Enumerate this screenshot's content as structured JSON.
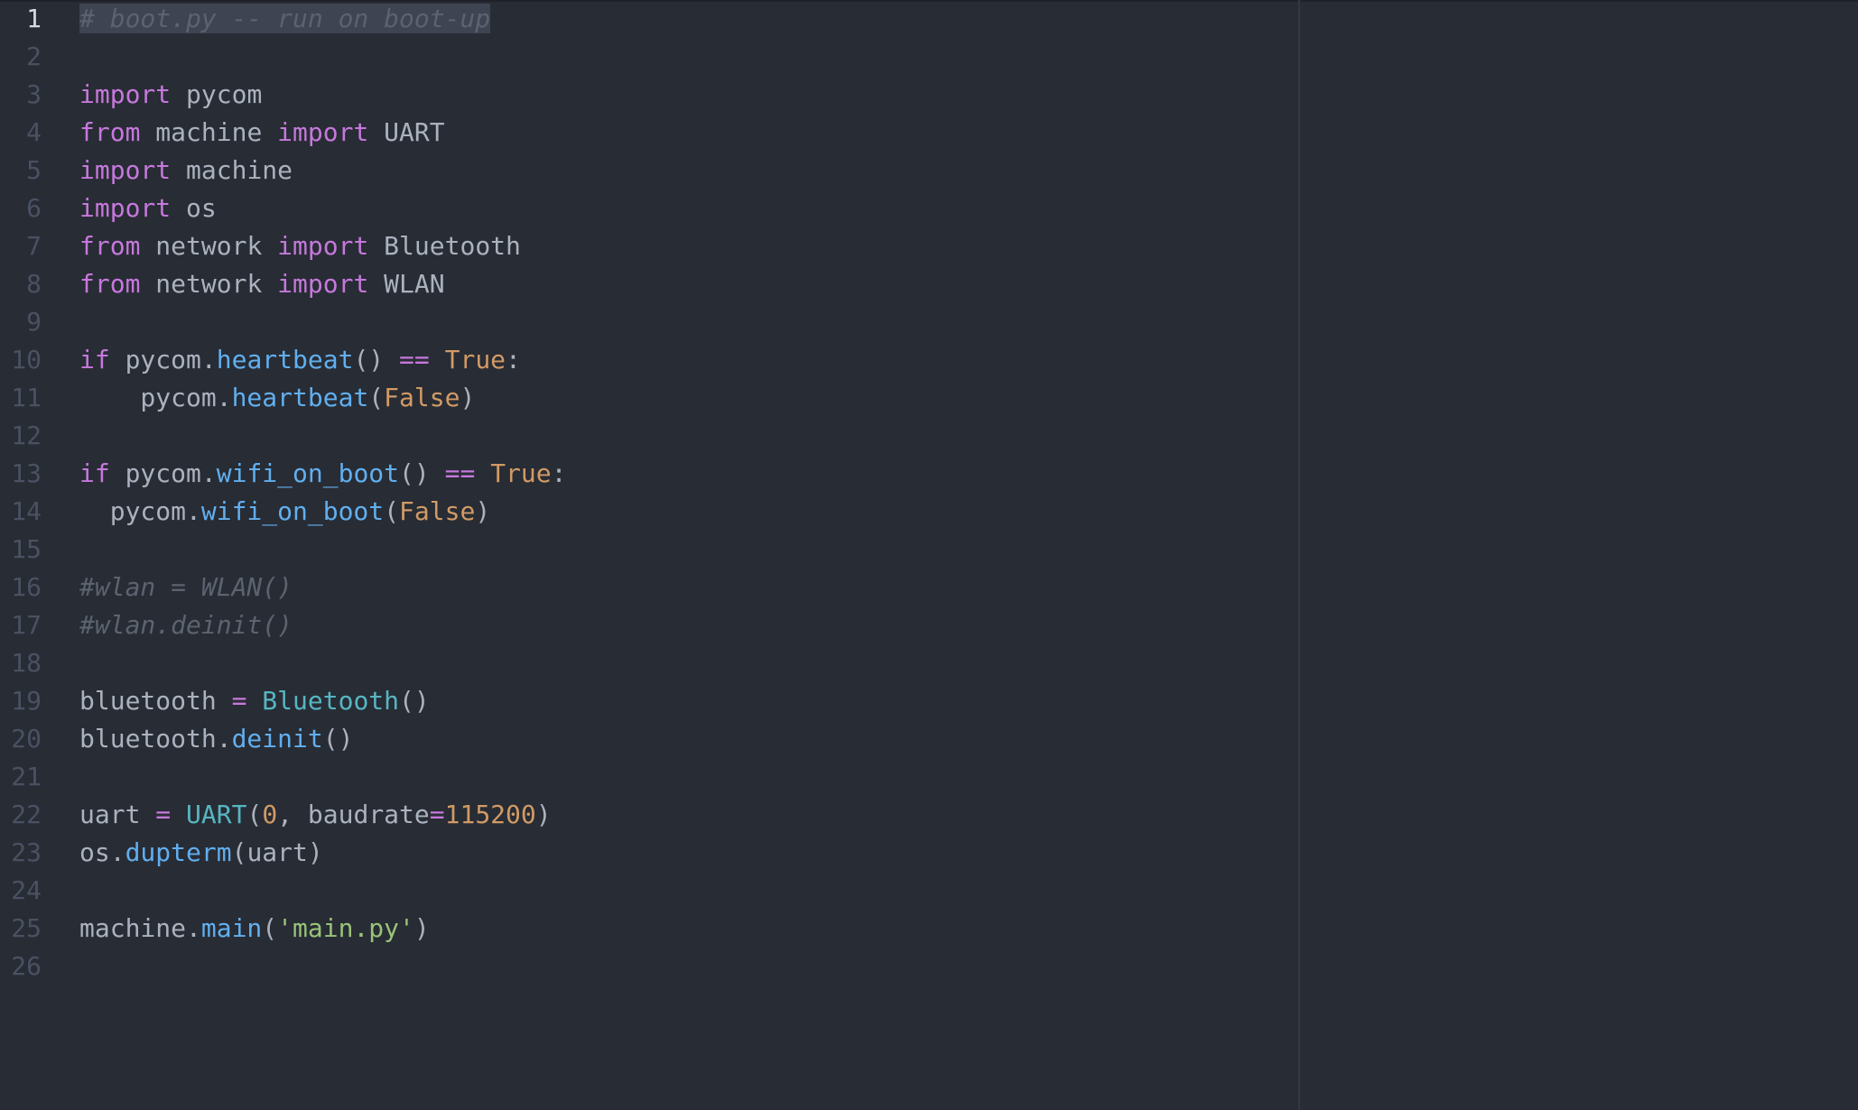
{
  "editor": {
    "file_name": "boot.py",
    "colors": {
      "background": "#282c34",
      "keyword": "#c678dd",
      "function": "#61afef",
      "class": "#56b6c2",
      "number": "#d19a66",
      "string": "#98c379",
      "comment": "#5c6370",
      "text": "#abb2bf"
    },
    "line_numbers": [
      "1",
      "2",
      "3",
      "4",
      "5",
      "6",
      "7",
      "8",
      "9",
      "10",
      "11",
      "12",
      "13",
      "14",
      "15",
      "16",
      "17",
      "18",
      "19",
      "20",
      "21",
      "22",
      "23",
      "24",
      "25",
      "26"
    ],
    "active_line": "1",
    "lines": [
      [
        {
          "t": "cmt",
          "v": "# boot.py -- run on boot-up"
        }
      ],
      [],
      [
        {
          "t": "kw",
          "v": "import"
        },
        {
          "t": "id",
          "v": " pycom"
        }
      ],
      [
        {
          "t": "kw",
          "v": "from"
        },
        {
          "t": "id",
          "v": " machine "
        },
        {
          "t": "kw",
          "v": "import"
        },
        {
          "t": "id",
          "v": " UART"
        }
      ],
      [
        {
          "t": "kw",
          "v": "import"
        },
        {
          "t": "id",
          "v": " machine"
        }
      ],
      [
        {
          "t": "kw",
          "v": "import"
        },
        {
          "t": "id",
          "v": " os"
        }
      ],
      [
        {
          "t": "kw",
          "v": "from"
        },
        {
          "t": "id",
          "v": " network "
        },
        {
          "t": "kw",
          "v": "import"
        },
        {
          "t": "id",
          "v": " Bluetooth"
        }
      ],
      [
        {
          "t": "kw",
          "v": "from"
        },
        {
          "t": "id",
          "v": " network "
        },
        {
          "t": "kw",
          "v": "import"
        },
        {
          "t": "id",
          "v": " WLAN"
        }
      ],
      [],
      [
        {
          "t": "kw",
          "v": "if"
        },
        {
          "t": "id",
          "v": " pycom."
        },
        {
          "t": "fn",
          "v": "heartbeat"
        },
        {
          "t": "id",
          "v": "() "
        },
        {
          "t": "op",
          "v": "=="
        },
        {
          "t": "id",
          "v": " "
        },
        {
          "t": "num",
          "v": "True"
        },
        {
          "t": "id",
          "v": ":"
        }
      ],
      [
        {
          "t": "id",
          "v": "    pycom."
        },
        {
          "t": "fn",
          "v": "heartbeat"
        },
        {
          "t": "id",
          "v": "("
        },
        {
          "t": "num",
          "v": "False"
        },
        {
          "t": "id",
          "v": ")"
        }
      ],
      [],
      [
        {
          "t": "kw",
          "v": "if"
        },
        {
          "t": "id",
          "v": " pycom."
        },
        {
          "t": "fn",
          "v": "wifi_on_boot"
        },
        {
          "t": "id",
          "v": "() "
        },
        {
          "t": "op",
          "v": "=="
        },
        {
          "t": "id",
          "v": " "
        },
        {
          "t": "num",
          "v": "True"
        },
        {
          "t": "id",
          "v": ":"
        }
      ],
      [
        {
          "t": "id",
          "v": "  pycom."
        },
        {
          "t": "fn",
          "v": "wifi_on_boot"
        },
        {
          "t": "id",
          "v": "("
        },
        {
          "t": "num",
          "v": "False"
        },
        {
          "t": "id",
          "v": ")"
        }
      ],
      [],
      [
        {
          "t": "cmt",
          "v": "#wlan = WLAN()"
        }
      ],
      [
        {
          "t": "cmt",
          "v": "#wlan.deinit()"
        }
      ],
      [],
      [
        {
          "t": "id",
          "v": "bluetooth "
        },
        {
          "t": "op",
          "v": "="
        },
        {
          "t": "id",
          "v": " "
        },
        {
          "t": "cls",
          "v": "Bluetooth"
        },
        {
          "t": "id",
          "v": "()"
        }
      ],
      [
        {
          "t": "id",
          "v": "bluetooth."
        },
        {
          "t": "fn",
          "v": "deinit"
        },
        {
          "t": "id",
          "v": "()"
        }
      ],
      [],
      [
        {
          "t": "id",
          "v": "uart "
        },
        {
          "t": "op",
          "v": "="
        },
        {
          "t": "id",
          "v": " "
        },
        {
          "t": "cls",
          "v": "UART"
        },
        {
          "t": "id",
          "v": "("
        },
        {
          "t": "num",
          "v": "0"
        },
        {
          "t": "id",
          "v": ", baudrate"
        },
        {
          "t": "op",
          "v": "="
        },
        {
          "t": "num",
          "v": "115200"
        },
        {
          "t": "id",
          "v": ")"
        }
      ],
      [
        {
          "t": "id",
          "v": "os."
        },
        {
          "t": "fn",
          "v": "dupterm"
        },
        {
          "t": "id",
          "v": "(uart)"
        }
      ],
      [],
      [
        {
          "t": "id",
          "v": "machine."
        },
        {
          "t": "fn",
          "v": "main"
        },
        {
          "t": "id",
          "v": "("
        },
        {
          "t": "str",
          "v": "'main.py'"
        },
        {
          "t": "id",
          "v": ")"
        }
      ],
      []
    ]
  }
}
